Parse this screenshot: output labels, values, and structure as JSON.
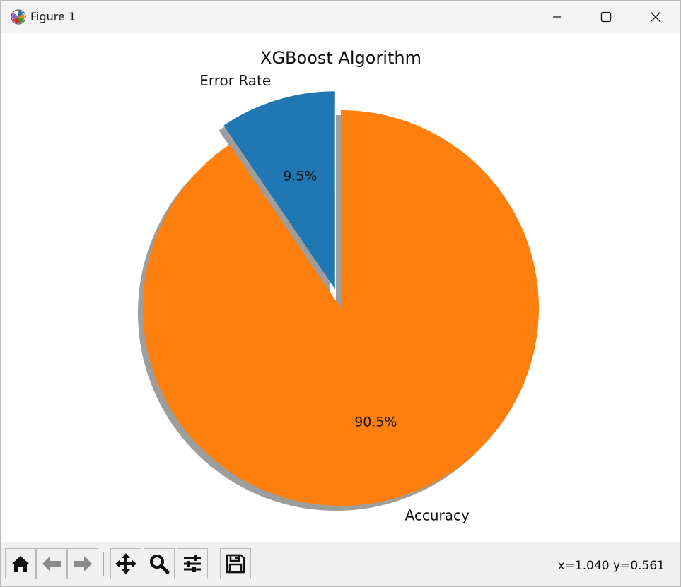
{
  "window": {
    "title": "Figure 1",
    "app_icon": "matplotlib-icon",
    "controls": {
      "minimize_icon": "minimize-icon",
      "maximize_icon": "maximize-icon",
      "close_icon": "close-icon"
    }
  },
  "chart_data": {
    "type": "pie",
    "title": "XGBoost Algorithm",
    "labels": [
      "Error Rate",
      "Accuracy"
    ],
    "values": [
      9.5,
      90.5
    ],
    "autopct_labels": [
      "9.5%",
      "90.5%"
    ],
    "colors": [
      "#1f77b4",
      "#ff7f0e"
    ],
    "explode": [
      0.1,
      0
    ],
    "shadow": true,
    "start_angle_deg": 90
  },
  "toolbar": {
    "buttons": [
      {
        "name": "home-button",
        "icon": "home-icon"
      },
      {
        "name": "back-button",
        "icon": "back-arrow-icon"
      },
      {
        "name": "forward-button",
        "icon": "forward-arrow-icon"
      },
      {
        "name": "pan-button",
        "icon": "pan-icon"
      },
      {
        "name": "zoom-button",
        "icon": "zoom-icon"
      },
      {
        "name": "configure-subplots-button",
        "icon": "sliders-icon"
      },
      {
        "name": "save-button",
        "icon": "save-icon"
      }
    ],
    "coordinates": "x=1.040 y=0.561"
  }
}
